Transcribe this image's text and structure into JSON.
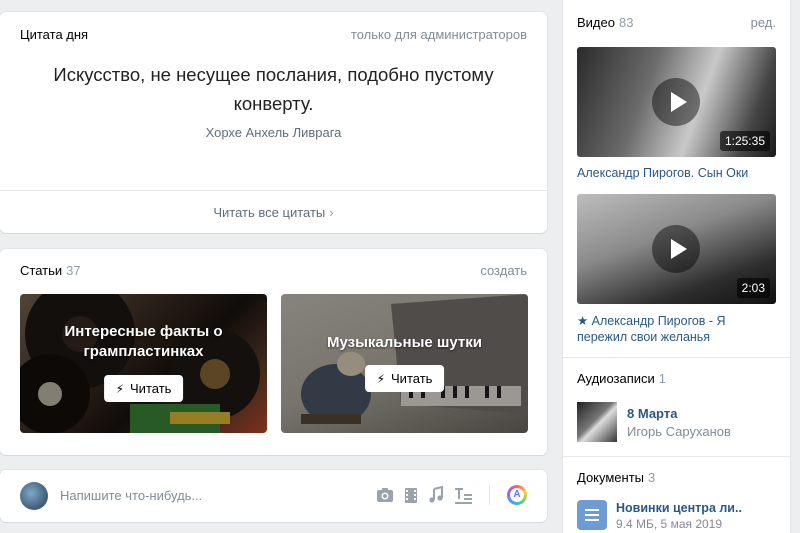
{
  "quote": {
    "title": "Цитата дня",
    "admin_note": "только для администраторов",
    "text": "Искусство, не несущее послания, подобно пустому конверту.",
    "author": "Хорхе Анхель Ливрага",
    "read_all": "Читать все цитаты"
  },
  "articles": {
    "title": "Статьи",
    "count": "37",
    "create": "создать",
    "items": [
      {
        "title": "Интересные факты о грампластинках",
        "button": "Читать"
      },
      {
        "title": "Музыкальные шутки",
        "button": "Читать"
      }
    ]
  },
  "post": {
    "placeholder": "Напишите что-нибудь...",
    "icons": [
      "camera-icon",
      "video-icon",
      "music-icon",
      "text-format-icon",
      "ai-icon"
    ]
  },
  "videos": {
    "title": "Видео",
    "count": "83",
    "edit": "ред.",
    "items": [
      {
        "title": "Александр Пирогов. Сын Оки",
        "duration": "1:25:35"
      },
      {
        "title": "★ Александр Пирогов - Я пережил свои желанья",
        "duration": "2:03"
      }
    ]
  },
  "audio": {
    "title": "Аудиозаписи",
    "count": "1",
    "items": [
      {
        "title": "8 Марта",
        "artist": "Игорь Саруханов"
      }
    ]
  },
  "documents": {
    "title": "Документы",
    "count": "3",
    "items": [
      {
        "title": "Новинки центра ли..",
        "meta": "9.4 МБ, 5 мая 2019"
      }
    ]
  }
}
